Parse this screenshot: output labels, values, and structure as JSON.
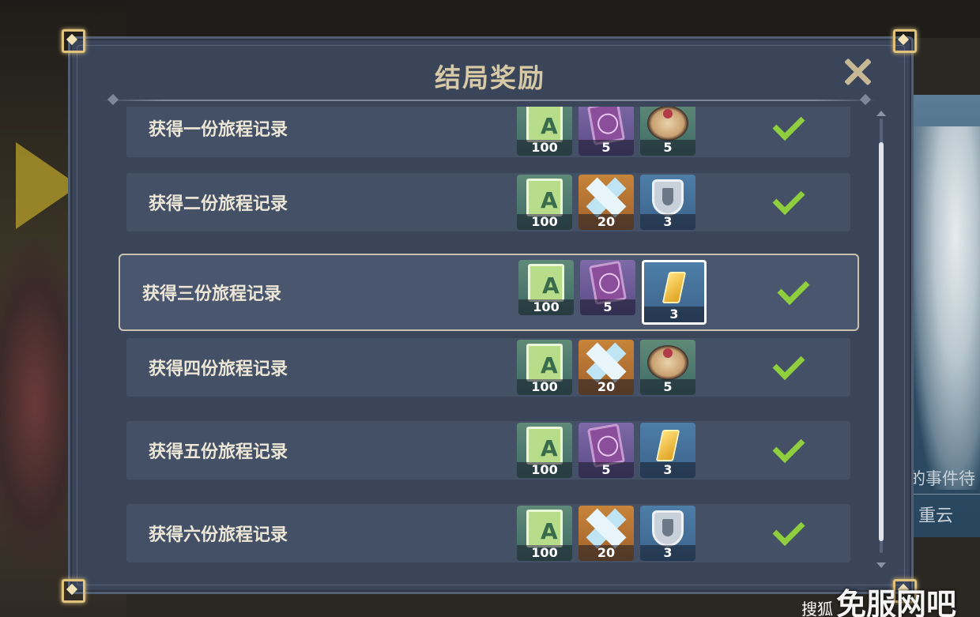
{
  "dialog": {
    "title": "结局奖励"
  },
  "background": {
    "event_text": "的事件待",
    "character_name": "重云"
  },
  "rows": [
    {
      "label": "获得一份旅程记录",
      "items": [
        {
          "icon": "exp-book-icon",
          "bg": "green",
          "qty": "100"
        },
        {
          "icon": "purple-book-icon",
          "bg": "purple",
          "qty": "5"
        },
        {
          "icon": "dish-icon",
          "bg": "green",
          "qty": "5"
        }
      ],
      "completed": true
    },
    {
      "label": "获得二份旅程记录",
      "items": [
        {
          "icon": "exp-book-icon",
          "bg": "green",
          "qty": "100"
        },
        {
          "icon": "crystal-icon",
          "bg": "orange",
          "qty": "20"
        },
        {
          "icon": "shield-icon",
          "bg": "blue",
          "qty": "3"
        }
      ],
      "completed": true
    },
    {
      "label": "获得三份旅程记录",
      "items": [
        {
          "icon": "exp-book-icon",
          "bg": "green",
          "qty": "100"
        },
        {
          "icon": "purple-book-icon",
          "bg": "purple",
          "qty": "5"
        },
        {
          "icon": "gold-fragment-icon",
          "bg": "blue",
          "qty": "3"
        }
      ],
      "completed": true
    },
    {
      "label": "获得四份旅程记录",
      "items": [
        {
          "icon": "exp-book-icon",
          "bg": "green",
          "qty": "100"
        },
        {
          "icon": "crystal-icon",
          "bg": "orange",
          "qty": "20"
        },
        {
          "icon": "dish-icon",
          "bg": "green",
          "qty": "5"
        }
      ],
      "completed": true
    },
    {
      "label": "获得五份旅程记录",
      "items": [
        {
          "icon": "exp-book-icon",
          "bg": "green",
          "qty": "100"
        },
        {
          "icon": "purple-book-icon",
          "bg": "purple",
          "qty": "5"
        },
        {
          "icon": "gold-fragment-icon",
          "bg": "blue",
          "qty": "3"
        }
      ],
      "completed": true
    },
    {
      "label": "获得六份旅程记录",
      "items": [
        {
          "icon": "exp-book-icon",
          "bg": "green",
          "qty": "100"
        },
        {
          "icon": "crystal-icon",
          "bg": "orange",
          "qty": "20"
        },
        {
          "icon": "shield-icon",
          "bg": "blue",
          "qty": "3"
        }
      ],
      "completed": true
    }
  ],
  "watermark": {
    "small": "搜狐",
    "big": "免服网吧"
  },
  "colors": {
    "panel": "#3b4559",
    "row": "#445066",
    "title": "#d8c9a5",
    "check": "#8fcf3d",
    "corner_gold": "#e0c27c"
  }
}
